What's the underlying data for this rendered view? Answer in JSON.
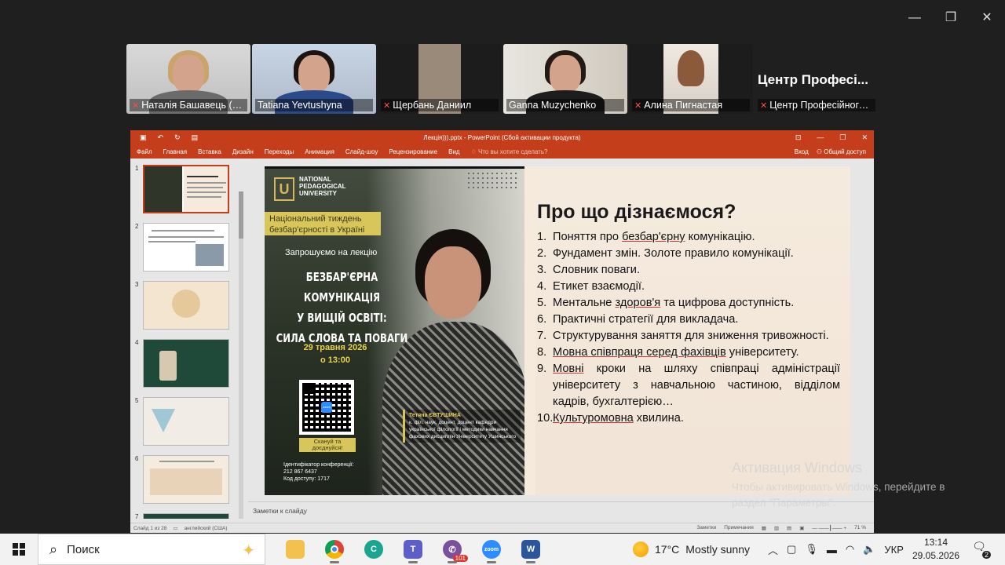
{
  "zoom": {
    "participants": [
      {
        "name": "Наталія Башавець (ви...",
        "muted": true
      },
      {
        "name": "Tatiana Yevtushyna",
        "muted": false,
        "active": true
      },
      {
        "name": "Щербань Даниил",
        "muted": true
      },
      {
        "name": "Ganna Muzychenko",
        "muted": false
      },
      {
        "name": "Алина Пигнастая",
        "muted": true
      },
      {
        "name": "Центр Професійного ...",
        "muted": true,
        "display_text": "Центр Професі..."
      }
    ]
  },
  "ppt": {
    "doc_title": "Лекція))).pptx - PowerPoint (Сбой активации продукта)",
    "tabs": [
      "Файл",
      "Главная",
      "Вставка",
      "Дизайн",
      "Переходы",
      "Анимация",
      "Слайд-шоу",
      "Рецензирование",
      "Вид"
    ],
    "tell_me": "Что вы хотите сделать?",
    "signin": "Вход",
    "share": "Общий доступ",
    "thumb_numbers": [
      "1",
      "2",
      "3",
      "4",
      "5",
      "6",
      "7"
    ],
    "notes_placeholder": "Заметки к слайду",
    "status_left": "Слайд 1 из 28",
    "status_lang": "английский (США)",
    "status_notes": "Заметки",
    "status_comments": "Примечания",
    "zoom_pct": "71 %"
  },
  "poster": {
    "university_line1": "NATIONAL",
    "university_line2": "PEDAGOGICAL",
    "university_line3": "UNIVERSITY",
    "banner": "Національний тиждень безбар'єрності в Україні",
    "invite": "Запрошуємо на лекцію",
    "topic_l1": "БЕЗБАР'ЄРНА КОМУНІКАЦІЯ",
    "topic_l2": "У ВИЩІЙ ОСВІТІ:",
    "topic_l3": "СИЛА СЛОВА ТА ПОВАГИ",
    "date_l1": "29 травня 2026",
    "date_l2": "о 13:00",
    "scan_l1": "Скануй та",
    "scan_l2": "доєднуйся!",
    "conf_l1": "Ідентифікатор конференції:",
    "conf_l2": "212 867 6437",
    "conf_l3": "Код доступу: 1717",
    "bio_name": "Тетяна ЄВТУШИНА",
    "bio_text": "к. філ. наук, доцент, доцент кафедри української філології і методики навчання фахових дисциплін Університету Ушинського"
  },
  "slide": {
    "title": "Про що дізнаємося?",
    "items": [
      {
        "n": "1.",
        "pre": "Поняття про ",
        "u": "безбар'єрну",
        "post": " комунікацію."
      },
      {
        "n": "2.",
        "pre": "Фундамент змін. Золоте правило комунікації.",
        "u": "",
        "post": ""
      },
      {
        "n": "3.",
        "pre": "Словник поваги.",
        "u": "",
        "post": ""
      },
      {
        "n": "4.",
        "pre": "Етикет взаємодії.",
        "u": "",
        "post": ""
      },
      {
        "n": "5.",
        "pre": "Ментальне ",
        "u": "здоров'я",
        "post": " та цифрова доступність."
      },
      {
        "n": "6.",
        "pre": "Практичні стратегії для викладача.",
        "u": "",
        "post": ""
      },
      {
        "n": "7.",
        "pre": "Структурування заняття для зниження тривожності.",
        "u": "",
        "post": ""
      },
      {
        "n": "8.",
        "pre": "",
        "u": "Мовна співпраця серед фахівців",
        "post": " університету."
      },
      {
        "n": "9.",
        "pre": "",
        "u": "Мовні",
        "post": " кроки на шляху співпраці адміністрації університету з навчальною частиною, відділом кадрів, бухгалтерією…"
      },
      {
        "n": "10.",
        "pre": "",
        "u": "Культуромовна",
        "post": " хвилина."
      }
    ]
  },
  "activation": {
    "title": "Активация Windows",
    "line1": "Чтобы активировать Windows, перейдите в",
    "line2": "раздел \"Параметры\"."
  },
  "taskbar": {
    "search_placeholder": "Поиск",
    "viber_badge": "101",
    "zoom_label": "zoom",
    "weather_temp": "17°C",
    "weather_desc": "Mostly sunny",
    "lang": "УКР",
    "time": "13:14",
    "date": "29.05.2026",
    "notif_count": "2"
  }
}
